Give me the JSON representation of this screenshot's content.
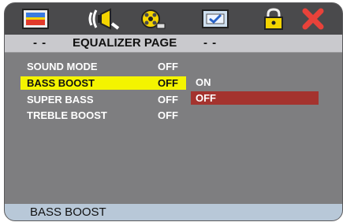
{
  "toolbar": {
    "icons": [
      "general-setup-icon",
      "audio-setup-icon",
      "video-setup-icon",
      "preference-icon",
      "password-icon",
      "exit-icon"
    ]
  },
  "title": {
    "dash_left": "- -",
    "text": "EQUALIZER PAGE",
    "dash_right": "- -"
  },
  "menu": {
    "items": [
      {
        "label": "SOUND MODE",
        "value": "OFF"
      },
      {
        "label": "BASS BOOST",
        "value": "OFF"
      },
      {
        "label": "SUPER BASS",
        "value": "OFF"
      },
      {
        "label": "TREBLE BOOST",
        "value": "OFF"
      }
    ],
    "selected_index": 1
  },
  "submenu": {
    "options": [
      "ON",
      "OFF"
    ],
    "selected_index": 1
  },
  "status": {
    "text": "BASS BOOST"
  },
  "colors": {
    "highlight": "#f4f400",
    "option_highlight": "#a4332e",
    "panel": "#7e7e80"
  }
}
